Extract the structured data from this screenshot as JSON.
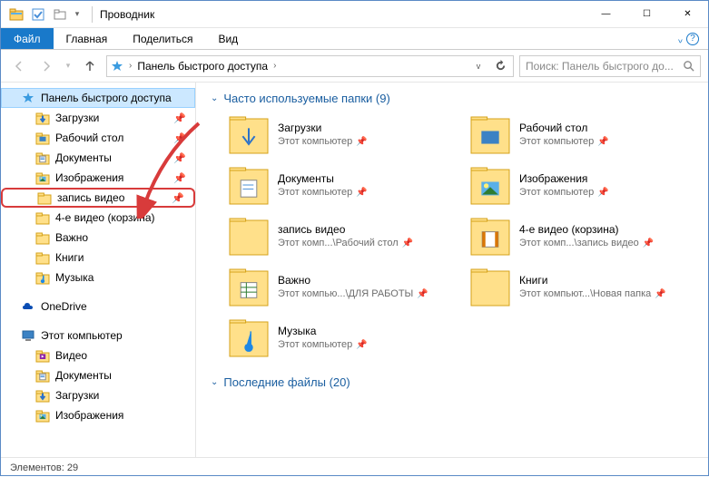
{
  "window": {
    "title": "Проводник",
    "minimize": "—",
    "maximize": "☐",
    "close": "✕"
  },
  "ribbon": {
    "file": "Файл",
    "home": "Главная",
    "share": "Поделиться",
    "view": "Вид"
  },
  "nav": {
    "address_root": "Панель быстрого доступа",
    "search_placeholder": "Поиск: Панель быстрого до..."
  },
  "sidebar": {
    "quick_access": "Панель быстрого доступа",
    "items_pinned": [
      {
        "label": "Загрузки",
        "icon": "downloads",
        "pinned": true
      },
      {
        "label": "Рабочий стол",
        "icon": "desktop",
        "pinned": true
      },
      {
        "label": "Документы",
        "icon": "documents",
        "pinned": true
      },
      {
        "label": "Изображения",
        "icon": "pictures",
        "pinned": true
      },
      {
        "label": "запись видео",
        "icon": "folder",
        "pinned": true,
        "highlighted": true
      },
      {
        "label": "4-е видео (корзина)",
        "icon": "folder",
        "pinned": false
      },
      {
        "label": "Важно",
        "icon": "folder",
        "pinned": false
      },
      {
        "label": "Книги",
        "icon": "folder",
        "pinned": false
      },
      {
        "label": "Музыка",
        "icon": "music",
        "pinned": false
      }
    ],
    "onedrive": "OneDrive",
    "this_pc": "Этот компьютер",
    "pc_items": [
      {
        "label": "Видео",
        "icon": "videos"
      },
      {
        "label": "Документы",
        "icon": "documents"
      },
      {
        "label": "Загрузки",
        "icon": "downloads"
      },
      {
        "label": "Изображения",
        "icon": "pictures"
      }
    ]
  },
  "content": {
    "section_freq": "Часто используемые папки (9)",
    "section_recent": "Последние файлы (20)",
    "folders": [
      {
        "name": "Загрузки",
        "path": "Этот компьютер",
        "icon": "downloads"
      },
      {
        "name": "Рабочий стол",
        "path": "Этот компьютер",
        "icon": "desktop"
      },
      {
        "name": "Документы",
        "path": "Этот компьютер",
        "icon": "documents"
      },
      {
        "name": "Изображения",
        "path": "Этот компьютер",
        "icon": "pictures"
      },
      {
        "name": "запись видео",
        "path": "Этот комп...\\Рабочий стол",
        "icon": "folder"
      },
      {
        "name": "4-е видео (корзина)",
        "path": "Этот комп...\\запись видео",
        "icon": "videos-folder"
      },
      {
        "name": "Важно",
        "path": "Этот компью...\\ДЛЯ РАБОТЫ",
        "icon": "excel-folder"
      },
      {
        "name": "Книги",
        "path": "Этот компьют...\\Новая папка",
        "icon": "folder"
      },
      {
        "name": "Музыка",
        "path": "Этот компьютер",
        "icon": "music"
      }
    ]
  },
  "statusbar": {
    "elements": "Элементов: 29"
  }
}
